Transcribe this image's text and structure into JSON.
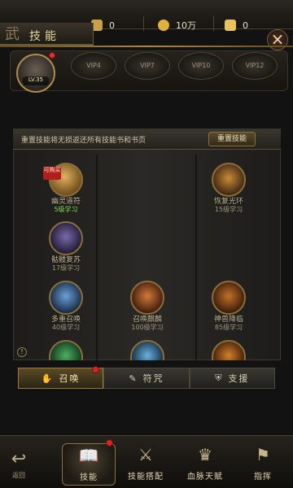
{
  "header": {
    "title": "技能",
    "title_glyph": "武",
    "resources": [
      {
        "icon": "ingot-icon",
        "value": "0",
        "color": "#c9a14a"
      },
      {
        "icon": "coin-icon",
        "value": "10万",
        "color": "#e0b13a"
      },
      {
        "icon": "gold-ingot-icon",
        "value": "0",
        "color": "#e8c25a"
      }
    ],
    "close_glyph": "×"
  },
  "player": {
    "level": "LV.35"
  },
  "vip_tabs": [
    "VIP4",
    "VIP7",
    "VIP10",
    "VIP12"
  ],
  "reset": {
    "text": "重置技能将无损返还所有技能书和书页",
    "button": "重置技能"
  },
  "skills": [
    {
      "name": "幽灵道符",
      "req": "5级学习",
      "available": true,
      "buy_tag": "可购买",
      "color": "#b88a3a"
    },
    {
      "name": "恢复光环",
      "req": "15级学习",
      "available": false,
      "color": "#9a6a2a"
    },
    {
      "name": "骷髅复苏",
      "req": "17级学习",
      "available": false,
      "color": "#5a4a8a"
    },
    {
      "name": "多重召唤",
      "req": "40级学习",
      "available": false,
      "color": "#3a6a9a"
    },
    {
      "name": "召唤麒麟",
      "req": "100级学习",
      "available": false,
      "color": "#a0521e"
    },
    {
      "name": "神兽降临",
      "req": "85级学习",
      "available": false,
      "color": "#8a4a1a"
    },
    {
      "name": "",
      "req": "",
      "available": false,
      "color": "#2f7a3a"
    },
    {
      "name": "",
      "req": "",
      "available": false,
      "color": "#3a7aa0"
    },
    {
      "name": "",
      "req": "",
      "available": false,
      "color": "#9a5a1a"
    }
  ],
  "category_tabs": [
    {
      "label": "召唤",
      "icon": "hand-icon",
      "glyph": "✋",
      "active": true,
      "dot": true
    },
    {
      "label": "符咒",
      "icon": "talisman-icon",
      "glyph": "✎",
      "active": false,
      "dot": false
    },
    {
      "label": "支援",
      "icon": "shield-icon",
      "glyph": "⛨",
      "active": false,
      "dot": false
    }
  ],
  "bottom_nav": {
    "back": {
      "label": "返回",
      "glyph": "↩"
    },
    "items": [
      {
        "label": "技能",
        "icon": "skill-book-icon",
        "glyph": "📖",
        "active": true
      },
      {
        "label": "技能搭配",
        "icon": "skill-combo-icon",
        "glyph": "⚔",
        "active": false
      },
      {
        "label": "血脉天赋",
        "icon": "bloodline-icon",
        "glyph": "♛",
        "active": false
      },
      {
        "label": "指挥",
        "icon": "command-icon",
        "glyph": "⚑",
        "active": false
      }
    ]
  }
}
